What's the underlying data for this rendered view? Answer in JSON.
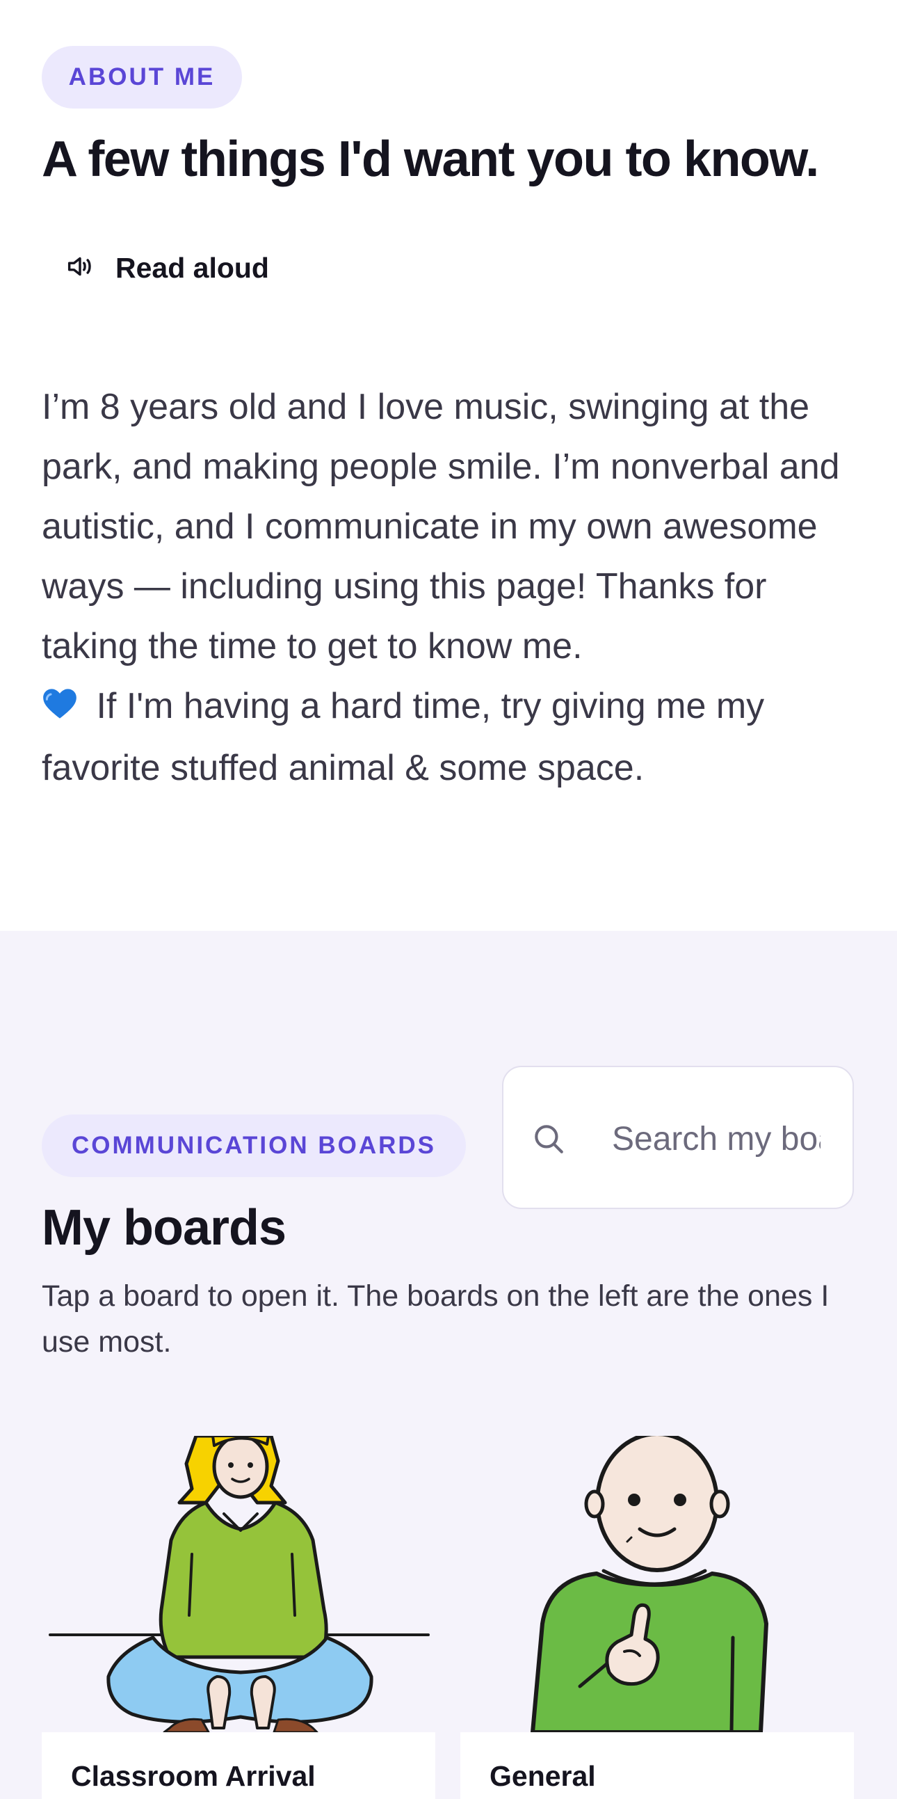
{
  "about": {
    "badge": "ABOUT ME",
    "title": "A few things I'd want you to know.",
    "read_aloud_label": "Read aloud",
    "bio_text": "I’m 8 years old and I love music, swinging at the park, and making people smile. I’m nonverbal and autistic, and I communicate in my own awesome ways — including using this page! Thanks for taking the time to get to know me.",
    "heart_emoji": "💙",
    "bio_text_2": " If I'm having a hard time, try giving me my favorite stuffed animal & some space."
  },
  "boards": {
    "badge": "COMMUNICATION BOARDS",
    "title": "My boards",
    "subtitle": "Tap a board to open it. The boards on the left are the ones I use most.",
    "search": {
      "placeholder": "Search my boards",
      "value": "",
      "icon": "search-icon"
    },
    "items": [
      {
        "label": "Classroom Arrival",
        "image": "girl-sitting-cross-legged-illustration"
      },
      {
        "label": "General",
        "image": "boy-pointing-to-self-illustration"
      }
    ]
  },
  "colors": {
    "accent": "#5a46d6",
    "pill_bg": "#ece9fd",
    "section_bg": "#f5f3fb",
    "heading": "#15141f",
    "body_text": "#3a3847",
    "heart": "#1f7ae0"
  }
}
